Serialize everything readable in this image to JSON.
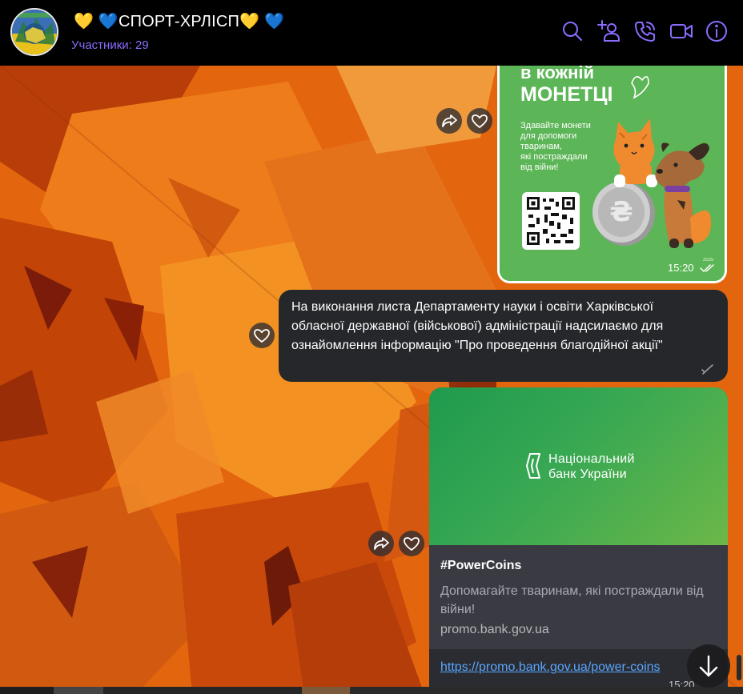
{
  "header": {
    "title": "💛 💙СПОРТ-ХРЛІСП💛 💙",
    "subtitle": "Участники: 29",
    "icons": [
      "search-icon",
      "add-user-icon",
      "call-icon",
      "video-icon",
      "info-icon"
    ]
  },
  "colors": {
    "accent": "#8c6cff",
    "bubble": "#26272b",
    "link": "#58a6ff",
    "card": "#3a3b42"
  },
  "image_message": {
    "poster_line1": "в кожній",
    "poster_line2": "МОНЕТЦІ",
    "poster_caption": [
      "Здавайте монети",
      "для допомоги",
      "тваринам,",
      "які постраждали",
      "від війни!"
    ],
    "coin_symbol": "₴",
    "coin_year": "2025",
    "time": "15:20"
  },
  "text_message": {
    "lines": [
      "На виконання листа Департаменту науки і освіти Харківської",
      "обласної державної (військової) адміністрації надсилаємо для",
      "ознайомлення інформацію \"Про проведення благодійної акції\""
    ]
  },
  "link_message": {
    "preview_brand_line1": "Національний",
    "preview_brand_line2": "банк України",
    "title": "#PowerCoins",
    "description": "Допомагайте тваринам, які постраждали від війни!",
    "domain": "promo.bank.gov.ua",
    "url": "https://promo.bank.gov.ua/power-coins",
    "time": "15:20"
  }
}
